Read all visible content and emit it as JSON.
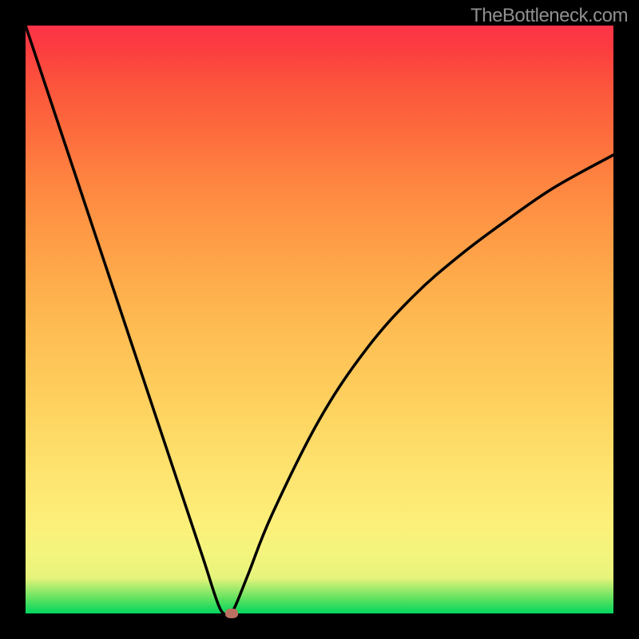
{
  "watermark": "TheBottleneck.com",
  "colors": {
    "frame": "#000000",
    "curve": "#000000",
    "marker": "#bb7161",
    "gradient_top": "#fb3348",
    "gradient_bottom": "#00d65f"
  },
  "chart_data": {
    "type": "line",
    "title": "",
    "xlabel": "",
    "ylabel": "",
    "xlim": [
      0,
      100
    ],
    "ylim": [
      0,
      100
    ],
    "x": [
      0,
      5,
      10,
      15,
      20,
      25,
      30,
      33,
      34.5,
      35,
      36,
      38,
      42,
      50,
      58,
      66,
      74,
      82,
      90,
      100
    ],
    "values": [
      100,
      85.0,
      70.0,
      55.0,
      40.0,
      25.0,
      10.0,
      1.0,
      0.0,
      0.0,
      2.0,
      7.0,
      17.0,
      33.0,
      45.0,
      54.0,
      61.0,
      67.0,
      72.5,
      78.0
    ],
    "marker": {
      "x": 35.0,
      "y": 0.0
    }
  }
}
